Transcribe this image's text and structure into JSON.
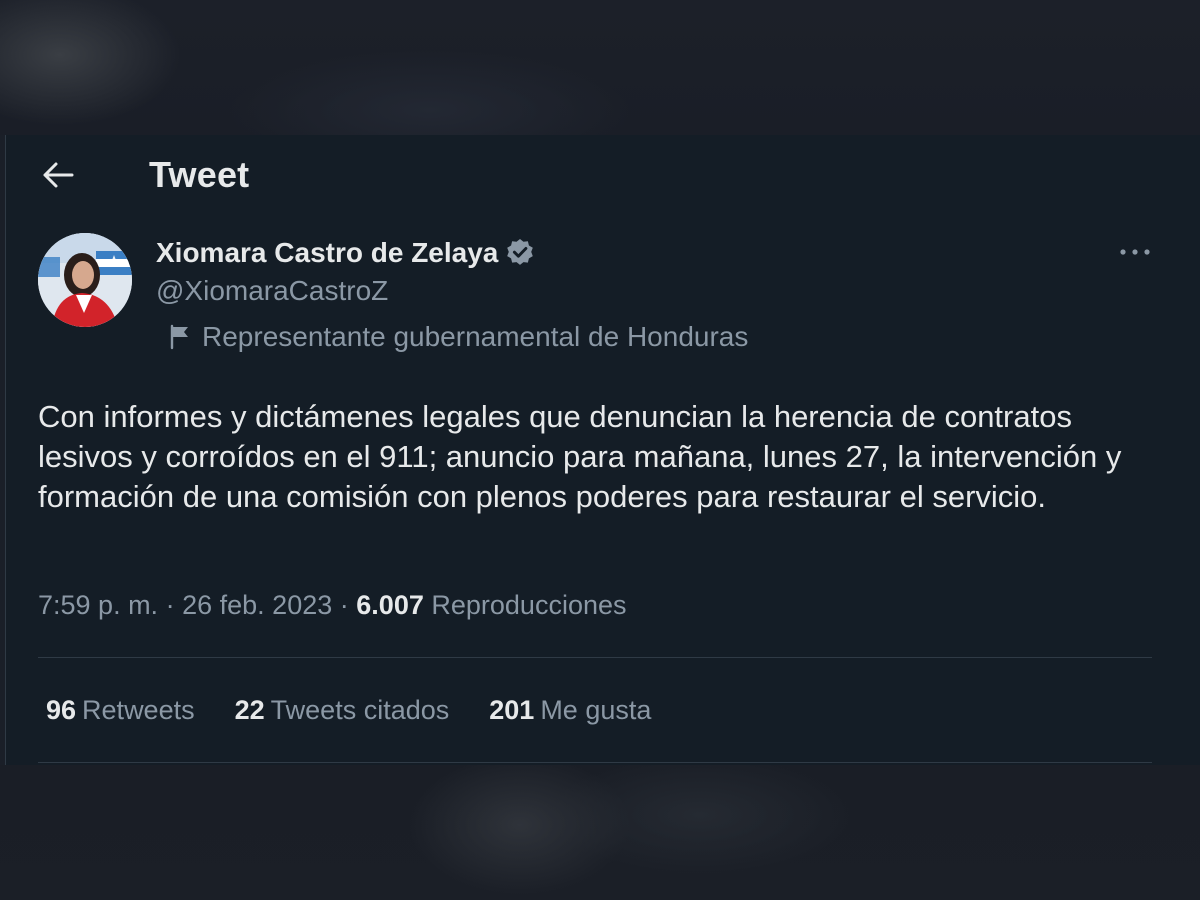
{
  "header": {
    "title": "Tweet",
    "back_icon": "arrow-left-icon"
  },
  "author": {
    "display_name": "Xiomara Castro de Zelaya",
    "handle": "@XiomaraCastroZ",
    "verified_icon": "verified-badge-icon",
    "affiliation": "Representante gubernamental de Honduras",
    "affiliation_icon": "flag-icon"
  },
  "tweet": {
    "text": "Con informes y dictámenes legales que denuncian la herencia de contratos lesivos y corroídos en el 911; anuncio para mañana, lunes 27, la intervención y formación de una comisión con plenos poderes para restaurar el servicio.",
    "time": "7:59 p. m.",
    "separator": "·",
    "date": "26 feb. 2023",
    "views_count": "6.007",
    "views_label": "Reproducciones"
  },
  "stats": {
    "retweets_count": "96",
    "retweets_label": "Retweets",
    "quotes_count": "22",
    "quotes_label": "Tweets citados",
    "likes_count": "201",
    "likes_label": "Me gusta"
  },
  "colors": {
    "background": "#141d26",
    "text_primary": "#e7e9ea",
    "text_secondary": "#8b98a5",
    "verified_badge": "#8b98a5",
    "divider": "#2f3a45"
  }
}
